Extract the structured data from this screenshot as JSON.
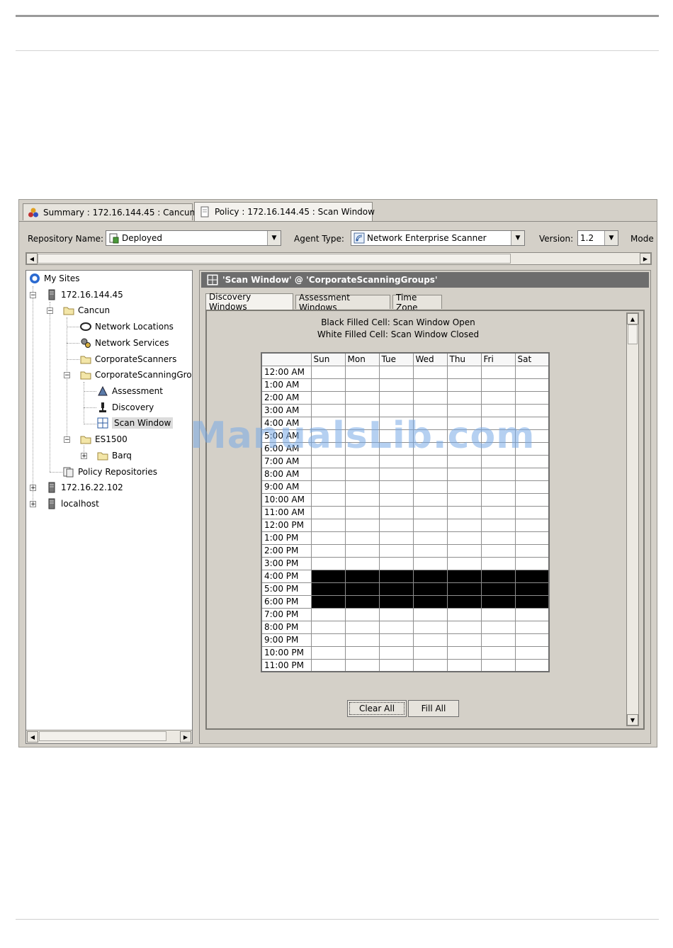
{
  "tabs": [
    {
      "label": "Summary : 172.16.144.45 : Cancun",
      "icon": "summary-icon"
    },
    {
      "label": "Policy : 172.16.144.45 : Scan Window",
      "icon": "policy-document-icon"
    }
  ],
  "toolbar": {
    "repository_label": "Repository Name:",
    "repository_value": "Deployed",
    "agent_label": "Agent Type:",
    "agent_value": "Network Enterprise Scanner",
    "version_label": "Version:",
    "version_value": "1.2",
    "mode_label": "Mode"
  },
  "tree": {
    "root": "My Sites",
    "items": [
      {
        "label": "172.16.144.45",
        "icon": "server-icon"
      },
      {
        "label": "Cancun",
        "icon": "folder-icon"
      },
      {
        "label": "Network Locations",
        "icon": "network-locations-icon"
      },
      {
        "label": "Network Services",
        "icon": "network-services-icon"
      },
      {
        "label": "CorporateScanners",
        "icon": "folder-icon"
      },
      {
        "label": "CorporateScanningGrou",
        "icon": "folder-icon"
      },
      {
        "label": "Assessment",
        "icon": "assessment-icon"
      },
      {
        "label": "Discovery",
        "icon": "discovery-microscope-icon"
      },
      {
        "label": "Scan Window",
        "icon": "scan-window-grid-icon"
      },
      {
        "label": "ES1500",
        "icon": "folder-icon"
      },
      {
        "label": "Barq",
        "icon": "folder-icon"
      },
      {
        "label": "Policy Repositories",
        "icon": "policy-repositories-icon"
      },
      {
        "label": "172.16.22.102",
        "icon": "server-icon"
      },
      {
        "label": "localhost",
        "icon": "server-icon"
      }
    ]
  },
  "panel": {
    "title": "'Scan Window' @ 'CorporateScanningGroups'",
    "subtabs": [
      "Discovery Windows",
      "Assessment Windows",
      "Time Zone"
    ],
    "legend_open": "Black Filled Cell: Scan Window Open",
    "legend_closed": "White Filled Cell: Scan Window Closed",
    "days": [
      "Sun",
      "Mon",
      "Tue",
      "Wed",
      "Thu",
      "Fri",
      "Sat"
    ],
    "times": [
      "12:00 AM",
      "1:00 AM",
      "2:00 AM",
      "3:00 AM",
      "4:00 AM",
      "5:00 AM",
      "6:00 AM",
      "7:00 AM",
      "8:00 AM",
      "9:00 AM",
      "10:00 AM",
      "11:00 AM",
      "12:00 PM",
      "1:00 PM",
      "2:00 PM",
      "3:00 PM",
      "4:00 PM",
      "5:00 PM",
      "6:00 PM",
      "7:00 PM",
      "8:00 PM",
      "9:00 PM",
      "10:00 PM",
      "11:00 PM"
    ],
    "open_hours": [
      "4:00 PM",
      "5:00 PM",
      "6:00 PM"
    ],
    "clear_all_label": "Clear All",
    "fill_all_label": "Fill All"
  },
  "watermark": "ManualsLib.com"
}
